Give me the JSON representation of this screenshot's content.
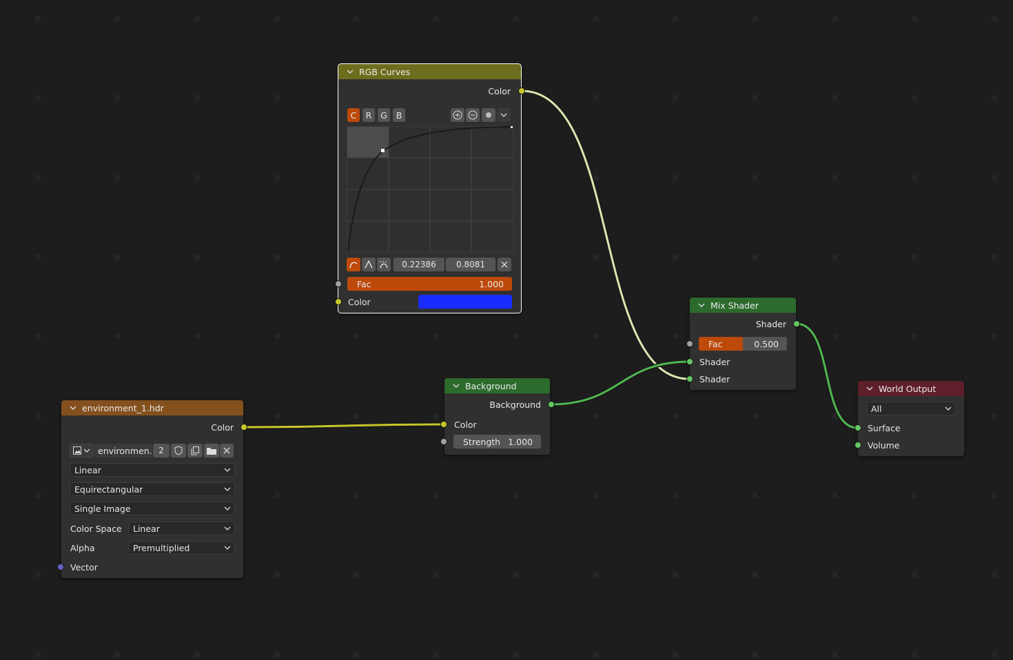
{
  "rgb_curves": {
    "title": "RGB Curves",
    "output_color_label": "Color",
    "channels": [
      "C",
      "R",
      "G",
      "B"
    ],
    "active_channel": "C",
    "point_x": "0.22386",
    "point_y": "0.8081",
    "fac_label": "Fac",
    "fac_value": "1.000",
    "fac_fraction": 1.0,
    "input_color_label": "Color",
    "input_color": "#1a2cff",
    "header_color": "#6d6d1e"
  },
  "mix_shader": {
    "title": "Mix Shader",
    "output_label": "Shader",
    "fac_label": "Fac",
    "fac_value": "0.500",
    "fac_fraction": 0.5,
    "shader1_label": "Shader",
    "shader2_label": "Shader",
    "header_color": "#2c6b2c"
  },
  "background": {
    "title": "Background",
    "output_label": "Background",
    "color_label": "Color",
    "strength_label": "Strength",
    "strength_value": "1.000",
    "header_color": "#2c6b2c"
  },
  "world_output": {
    "title": "World Output",
    "target": "All",
    "surface_label": "Surface",
    "volume_label": "Volume",
    "header_color": "#5e1f2b"
  },
  "environment": {
    "title": "environment_1.hdr",
    "output_label": "Color",
    "image_name": "environmen...",
    "users": "2",
    "interpolation": "Linear",
    "projection": "Equirectangular",
    "source": "Single Image",
    "color_space_label": "Color Space",
    "color_space": "Linear",
    "alpha_label": "Alpha",
    "alpha": "Premultiplied",
    "vector_label": "Vector",
    "header_color": "#84501e"
  },
  "colors": {
    "link_yellow": "#c7c729",
    "link_green": "#4fb84f",
    "fac_fill": "#bd4a0a"
  }
}
